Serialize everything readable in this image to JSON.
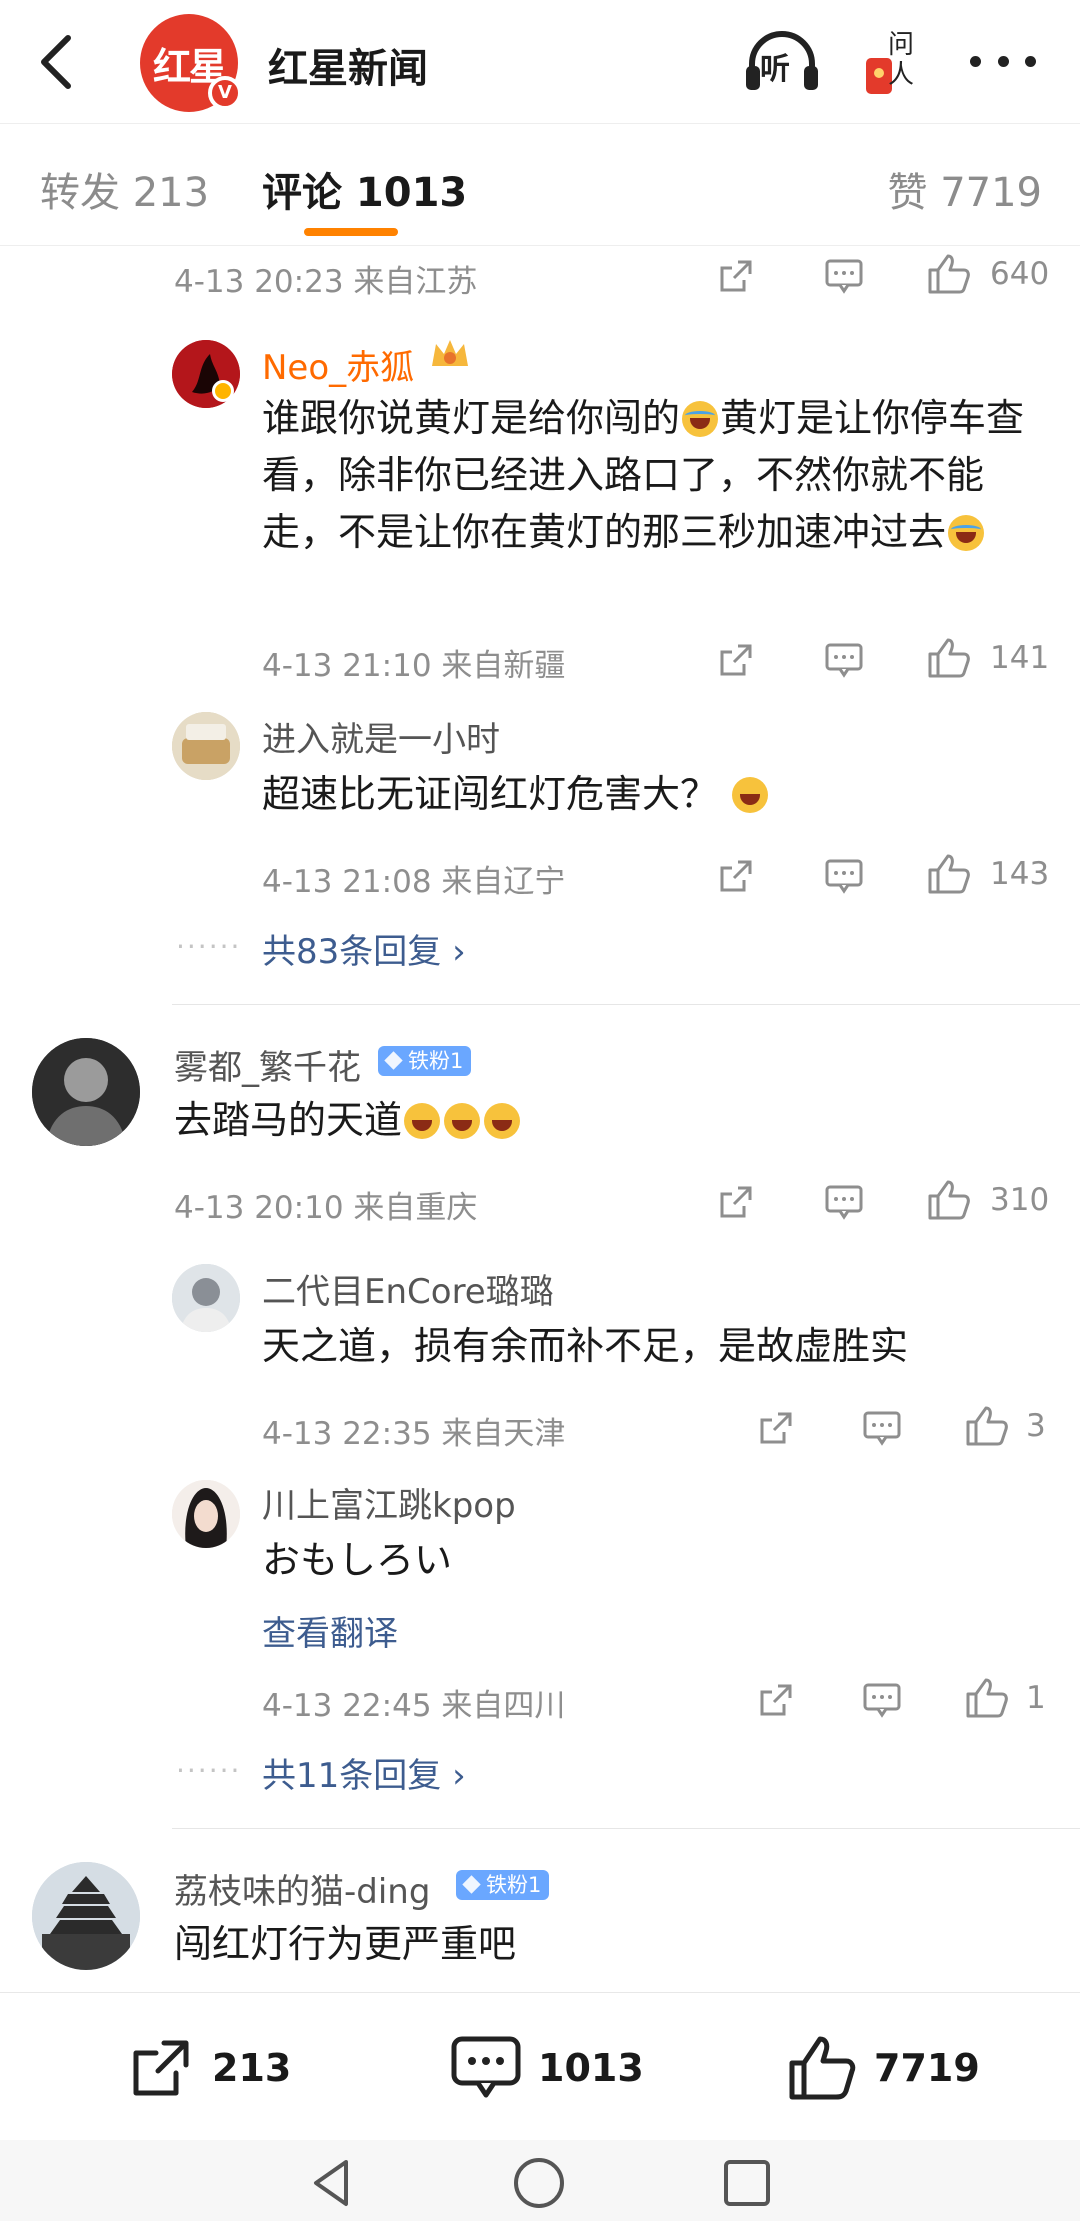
{
  "header": {
    "brand_logo_text": "红星",
    "brand_name": "红星新闻",
    "listen_label": "听",
    "ask_label": "问\n人"
  },
  "tabs": {
    "repost": "转发 213",
    "comment": "评论 1013",
    "likes": "赞 7719"
  },
  "comments": [
    {
      "meta": "4-13 20:23  来自江苏",
      "likes": "640"
    },
    {
      "name": "Neo_赤狐",
      "text_part1": "谁跟你说黄灯是给你闯的",
      "text_part2": "黄灯是让你停车查看，除非你已经进入路口了，不然你就不能走，不是让你在黄灯的那三秒加速冲过去",
      "meta": "4-13 21:10  来自新疆",
      "likes": "141"
    },
    {
      "name": "进入就是一小时",
      "text": "超速比无证闯红灯危害大？",
      "meta": "4-13 21:08  来自辽宁",
      "likes": "143"
    },
    {
      "more_replies": "共83条回复 ›"
    },
    {
      "name": "雾都_繁千花",
      "badge": "铁粉1",
      "text": "去踏马的天道",
      "meta": "4-13 20:10  来自重庆",
      "likes": "310"
    },
    {
      "name": "二代目EnCore璐璐",
      "text": "天之道，损有余而补不足，是故虚胜实",
      "meta": "4-13 22:35  来自天津",
      "likes": "3"
    },
    {
      "name": "川上富江跳kpop",
      "text": "おもしろい",
      "translate": "查看翻译",
      "meta": "4-13 22:45  来自四川",
      "likes": "1"
    },
    {
      "more_replies": "共11条回复 ›"
    },
    {
      "name": "荔枝味的猫-ding",
      "badge": "铁粉1",
      "text": "闯红灯行为更严重吧"
    }
  ],
  "dots": "······",
  "bottom_bar": {
    "repost_count": "213",
    "comment_count": "1013",
    "like_count": "7719"
  },
  "colors": {
    "accent": "#ff8200",
    "link": "#3d5c8f",
    "vip_name": "#ff6a00",
    "brand_red": "#e33a2b",
    "fan_badge": "#6aa7ff"
  }
}
